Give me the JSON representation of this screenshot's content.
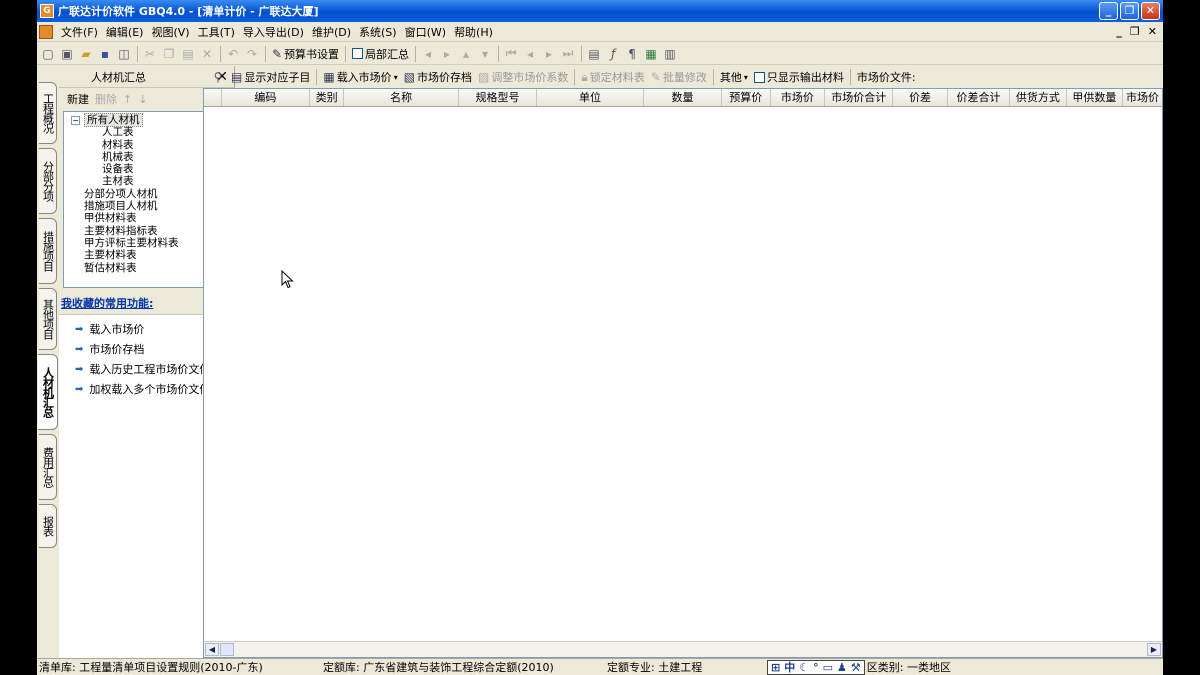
{
  "window": {
    "app_icon": "G",
    "title": "广联达计价软件 GBQ4.0 - [清单计价 - 广联达大厦]",
    "min": "_",
    "max": "❐",
    "close": "✕"
  },
  "menu": {
    "items": [
      "文件(F)",
      "编辑(E)",
      "视图(V)",
      "工具(T)",
      "导入导出(D)",
      "维护(D)",
      "系统(S)",
      "窗口(W)",
      "帮助(H)"
    ],
    "mdi_min": "_",
    "mdi_restore": "❐",
    "mdi_close": "✕"
  },
  "toolbar1": {
    "budget_settings": "预算书设置",
    "partial_summary": "局部汇总"
  },
  "left_tabs": [
    "工程概况",
    "分部分项",
    "措施项目",
    "其他项目",
    "人材机汇总",
    "费用汇总",
    "报表"
  ],
  "left_panel": {
    "title": "人材机汇总",
    "close": "✕",
    "new": "新建",
    "delete": "删除",
    "up": "↑",
    "down": "↓",
    "tree": {
      "root": "所有人材机",
      "expander": "−",
      "children": [
        "人工表",
        "材料表",
        "机械表",
        "设备表",
        "主材表"
      ],
      "siblings": [
        "分部分项人材机",
        "措施项目人材机",
        "甲供材料表",
        "主要材料指标表",
        "甲方评标主要材料表",
        "主要材料表",
        "暂估材料表"
      ]
    },
    "favorites_title": "我收藏的常用功能:",
    "favorites": [
      "载入市场价",
      "市场价存档",
      "载入历史工程市场价文件",
      "加权载入多个市场价文件"
    ]
  },
  "toolbar2": {
    "show_sub": "显示对应子目",
    "load_market": "载入市场价",
    "market_archive": "市场价存档",
    "adjust_coeff": "调整市场价系数",
    "lock_table": "锁定材料表",
    "batch_modify": "批量修改",
    "other": "其他",
    "only_output": "只显示输出材料",
    "market_file": "市场价文件:"
  },
  "grid": {
    "columns": [
      "编码",
      "类别",
      "名称",
      "规格型号",
      "单位",
      "数量",
      "预算价",
      "市场价",
      "市场价合计",
      "价差",
      "价差合计",
      "供货方式",
      "甲供数量",
      "市场价"
    ]
  },
  "status": {
    "list_lib": "清单库:  工程量清单项目设置规则(2010-广东)",
    "quota_lib": "定额库:  广东省建筑与装饰工程综合定额(2010)",
    "quota_major": "定额专业:  土建工程",
    "region": "区类别:  一类地区",
    "ime_mode": "中"
  }
}
